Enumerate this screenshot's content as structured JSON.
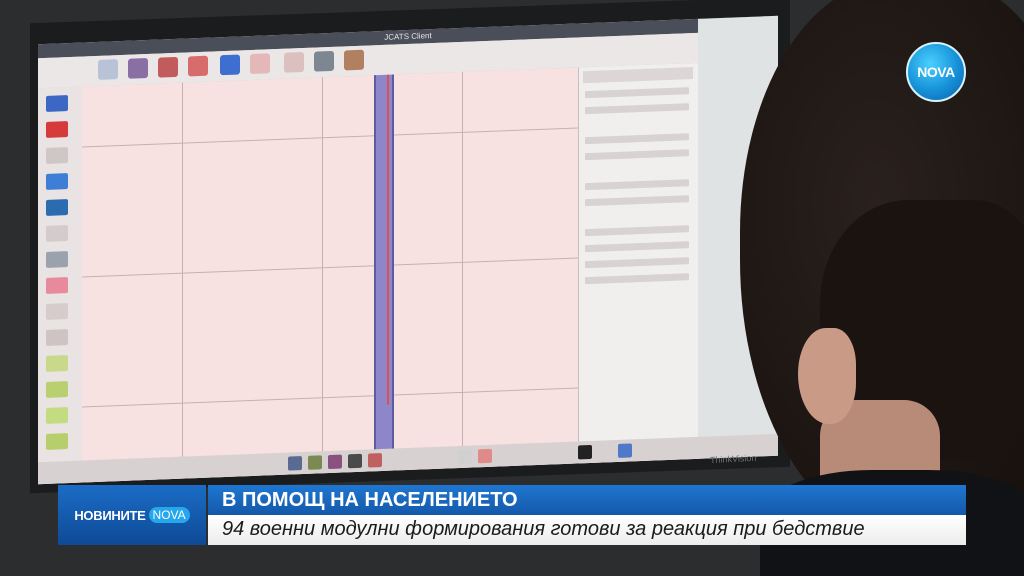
{
  "window": {
    "title": "JCATS Client"
  },
  "monitor": {
    "brand": "ThinkVision"
  },
  "channel_logo": {
    "text": "NOVA"
  },
  "lower_third": {
    "program_name": "НОВИНИТЕ",
    "program_logo": "NOVA",
    "headline": "В ПОМОЩ НА НАСЕЛЕНИЕТО",
    "subheadline": "94 военни модулни формирования готови за реакция при бедствие"
  },
  "colors": {
    "lower_third_blue": "#1f77d1",
    "map_background": "#f7e1e1",
    "track_purple": "#8d86c9"
  }
}
